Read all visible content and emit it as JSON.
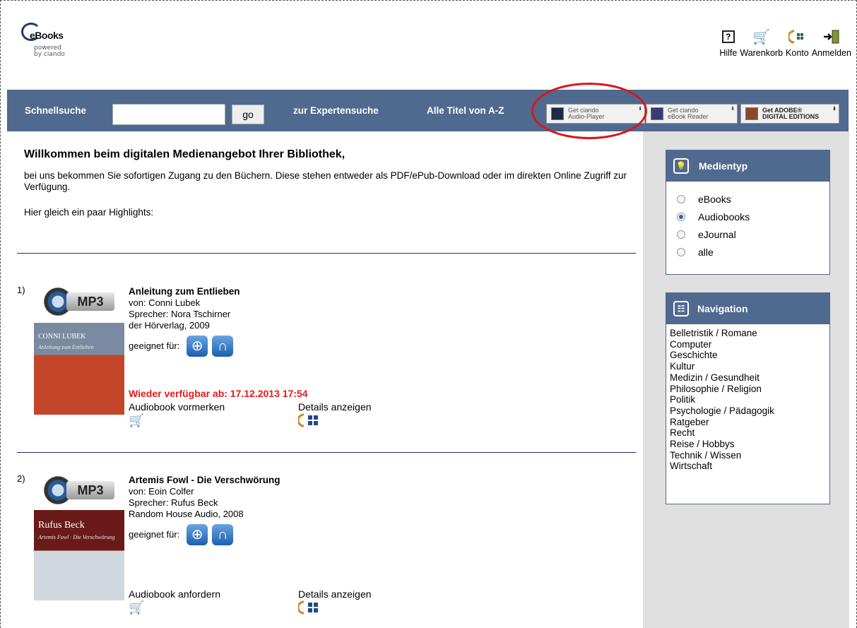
{
  "logo": {
    "brand": "eBooks",
    "powered": "powered",
    "by": "by ciando"
  },
  "topnav": {
    "help": "Hilfe",
    "cart": "Warenkorb",
    "account": "Konto",
    "login": "Anmelden"
  },
  "searchbar": {
    "quick_label": "Schnellsuche",
    "input_value": "",
    "go_label": "go",
    "expert_label": "zur Expertensuche",
    "az_label": "Alle Titel von A-Z",
    "badges": [
      {
        "line1": "Get ciando",
        "line2": "Audio-Player"
      },
      {
        "line1": "Get ciando",
        "line2": "eBook Reader"
      },
      {
        "line1": "Get ADOBE®",
        "line2": "DIGITAL EDITIONS"
      }
    ]
  },
  "main": {
    "welcome": "Willkommen beim digitalen Medienangebot Ihrer Bibliothek,",
    "intro": "bei uns bekommen Sie sofortigen Zugang zu den Büchern. Diese stehen entweder als PDF/ePub-Download oder im direkten Online Zugriff zur Verfügung.",
    "highlights": "Hier gleich ein paar Highlights:"
  },
  "entries": [
    {
      "num": "1)",
      "format": "MP3",
      "cover_title": "CONNI LUBEK",
      "cover_sub": "Anleitung zum Entlieben",
      "title": "Anleitung zum Entlieben",
      "author": "von: Conni Lubek",
      "speaker": "Sprecher: Nora Tschirner",
      "publisher": "der Hörverlag, 2009",
      "suitable": "geeignet für:",
      "availability": "Wieder verfügbar ab: 17.12.2013 17:54",
      "action": "Audiobook vormerken",
      "details": "Details anzeigen"
    },
    {
      "num": "2)",
      "format": "MP3",
      "cover_title": "Rufus Beck",
      "cover_sub": "Artemis Fowl · Die Verschwörung",
      "title": "Artemis Fowl - Die Verschwörung",
      "author": "von: Eoin Colfer",
      "speaker": "Sprecher: Rufus Beck",
      "publisher": "Random House Audio, 2008",
      "suitable": "geeignet für:",
      "availability": "",
      "action": "Audiobook anfordern",
      "details": "Details anzeigen"
    }
  ],
  "sidebar": {
    "mediatype": {
      "title": "Medientyp",
      "options": [
        "eBooks",
        "Audiobooks",
        "eJournal",
        "alle"
      ],
      "selected": "Audiobooks"
    },
    "navigation": {
      "title": "Navigation",
      "items": [
        "Belletristik / Romane",
        "Computer",
        "Geschichte",
        "Kultur",
        "Medizin / Gesundheit",
        "Philosophie / Religion",
        "Politik",
        "Psychologie / Pädagogik",
        "Ratgeber",
        "Recht",
        "Reise / Hobbys",
        "Technik / Wissen",
        "Wirtschaft"
      ]
    }
  },
  "colors": {
    "bar": "#50698f",
    "accent_red": "#e61a1a",
    "sidebar_bg": "#e0e0e0"
  }
}
